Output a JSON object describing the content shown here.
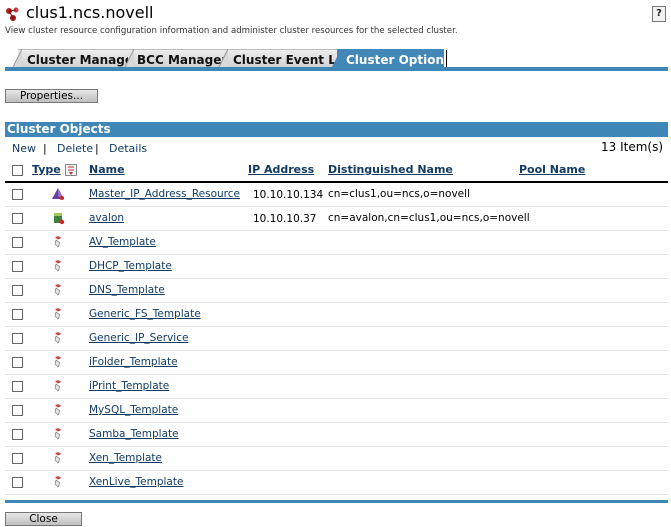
{
  "window": {
    "title": "clus1.ncs.novell",
    "subtitle": "View cluster resource configuration information and administer cluster resources for the selected cluster.",
    "help_label": "?"
  },
  "tabs": [
    {
      "label": "Cluster Manager",
      "active": false
    },
    {
      "label": "BCC Manager",
      "active": false
    },
    {
      "label": "Cluster Event Log",
      "active": false
    },
    {
      "label": "Cluster Options",
      "active": true
    }
  ],
  "buttons": {
    "properties": "Properties...",
    "close": "Close"
  },
  "section": {
    "title": "Cluster Objects",
    "actions": [
      "New",
      "Delete",
      "Details"
    ],
    "separator": "|",
    "count": "13 Item(s)"
  },
  "table": {
    "columns": [
      "Type",
      "Name",
      "IP Address",
      "Distinguished Name",
      "Pool Name"
    ],
    "rows": [
      {
        "icon": "ip-resource-icon",
        "name": "Master_IP_Address_Resource",
        "ip": "10.10.10.134",
        "dn": "cn=clus1,ou=ncs,o=novell",
        "pool": ""
      },
      {
        "icon": "cluster-node-icon",
        "name": "avalon",
        "ip": "10.10.10.37",
        "dn": "cn=avalon,cn=clus1,ou=ncs,o=novell",
        "pool": ""
      },
      {
        "icon": "template-icon",
        "name": "AV_Template",
        "ip": "",
        "dn": "",
        "pool": ""
      },
      {
        "icon": "template-icon",
        "name": "DHCP_Template",
        "ip": "",
        "dn": "",
        "pool": ""
      },
      {
        "icon": "template-icon",
        "name": "DNS_Template",
        "ip": "",
        "dn": "",
        "pool": ""
      },
      {
        "icon": "template-icon",
        "name": "Generic_FS_Template",
        "ip": "",
        "dn": "",
        "pool": ""
      },
      {
        "icon": "template-icon",
        "name": "Generic_IP_Service",
        "ip": "",
        "dn": "",
        "pool": ""
      },
      {
        "icon": "template-icon",
        "name": "iFolder_Template",
        "ip": "",
        "dn": "",
        "pool": ""
      },
      {
        "icon": "template-icon",
        "name": "iPrint_Template",
        "ip": "",
        "dn": "",
        "pool": ""
      },
      {
        "icon": "template-icon",
        "name": "MySQL_Template",
        "ip": "",
        "dn": "",
        "pool": ""
      },
      {
        "icon": "template-icon",
        "name": "Samba_Template",
        "ip": "",
        "dn": "",
        "pool": ""
      },
      {
        "icon": "template-icon",
        "name": "Xen_Template",
        "ip": "",
        "dn": "",
        "pool": ""
      },
      {
        "icon": "template-icon",
        "name": "XenLive_Template",
        "ip": "",
        "dn": "",
        "pool": ""
      }
    ]
  },
  "colors": {
    "accent": "#3f87b6",
    "link": "#123a63"
  }
}
